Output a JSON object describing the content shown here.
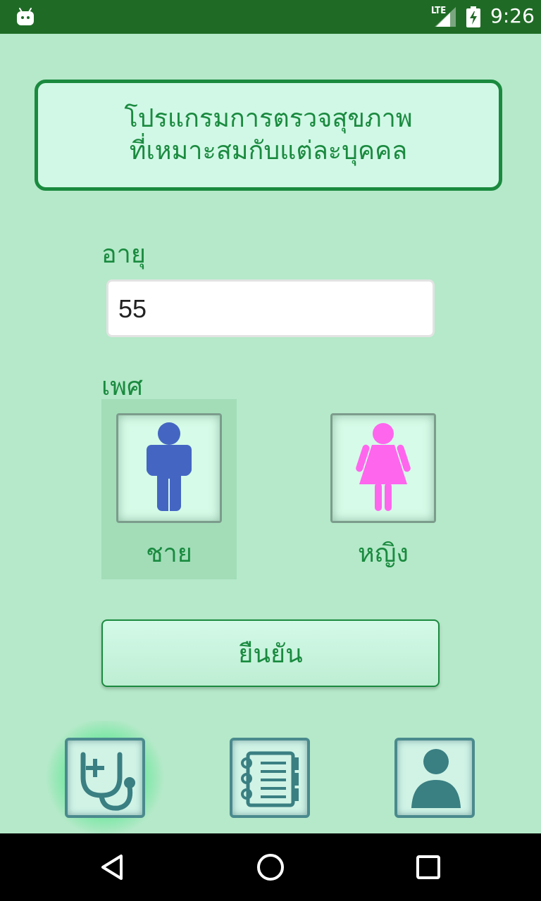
{
  "status_bar": {
    "network": "LTE",
    "time": "9:26"
  },
  "header": {
    "title_line1": "โปรแกรมการตรวจสุขภาพ",
    "title_line2": "ที่เหมาะสมกับแต่ละบุคคล"
  },
  "form": {
    "age_label": "อายุ",
    "age_value": "55",
    "sex_label": "เพศ",
    "options": [
      {
        "label": "ชาย",
        "icon": "male-icon",
        "selected": true,
        "color": "#4466c2"
      },
      {
        "label": "หญิง",
        "icon": "female-icon",
        "selected": false,
        "color": "#ff66ee"
      }
    ],
    "confirm_label": "ยืนยัน"
  },
  "bottom_nav": {
    "tabs": [
      {
        "icon": "stethoscope-icon",
        "active": true
      },
      {
        "icon": "notebook-icon",
        "active": false
      },
      {
        "icon": "person-icon",
        "active": false
      }
    ]
  },
  "colors": {
    "background": "#b5e9c9",
    "accent": "#1a8a3f",
    "status_bar": "#1f6b26",
    "icon_teal": "#3a7f82"
  }
}
